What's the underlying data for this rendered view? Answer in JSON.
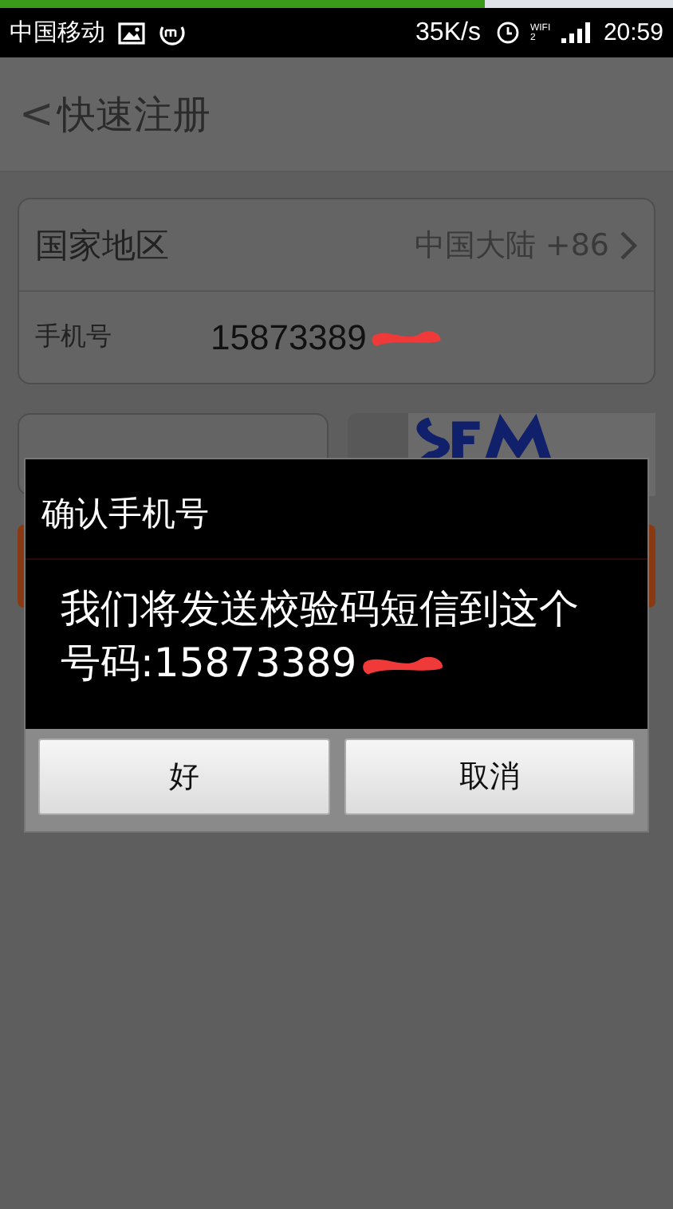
{
  "loading": {
    "level": 0.72
  },
  "status_bar": {
    "carrier": "中国移动",
    "speed": "35K/s",
    "time": "20:59",
    "network": "WIFI 2"
  },
  "header": {
    "back": "<",
    "title": "快速注册"
  },
  "form": {
    "rows": [
      {
        "kind": "select",
        "label": "国家地区",
        "value": "中国大陆 +86"
      },
      {
        "kind": "input",
        "label": "手机号",
        "value": "15873389",
        "redacted": true
      }
    ]
  },
  "dialog": {
    "title": "确认手机号",
    "message": "我们将发送校验码短信到这个号码:15873389",
    "redacted": true,
    "buttons": [
      {
        "label": "好"
      },
      {
        "label": "取消"
      }
    ]
  }
}
